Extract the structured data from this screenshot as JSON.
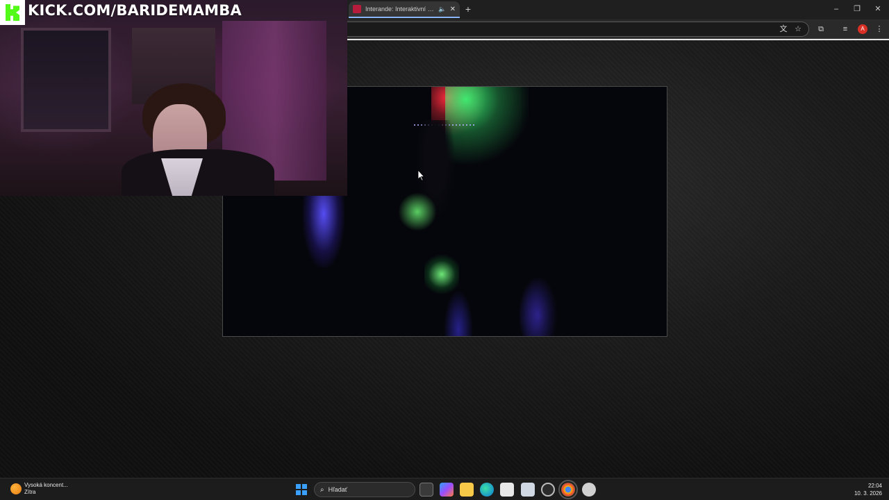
{
  "overlay": {
    "kick_url": "KICK.COM/BARIDEMAMBA"
  },
  "browser": {
    "tab_title": "Interande: Interaktivní film",
    "new_tab_label": "+",
    "profile_initial": "A"
  },
  "taskbar": {
    "weather_line1": "Vysoká koncent...",
    "weather_line2": "Zítra",
    "search_placeholder": "Hľadať",
    "time": "22:04",
    "date": "10. 3. 2026"
  },
  "colors": {
    "kick_green": "#53fc18",
    "tab_accent": "#8ab4f8",
    "start_blue": "#3aa0ff"
  }
}
